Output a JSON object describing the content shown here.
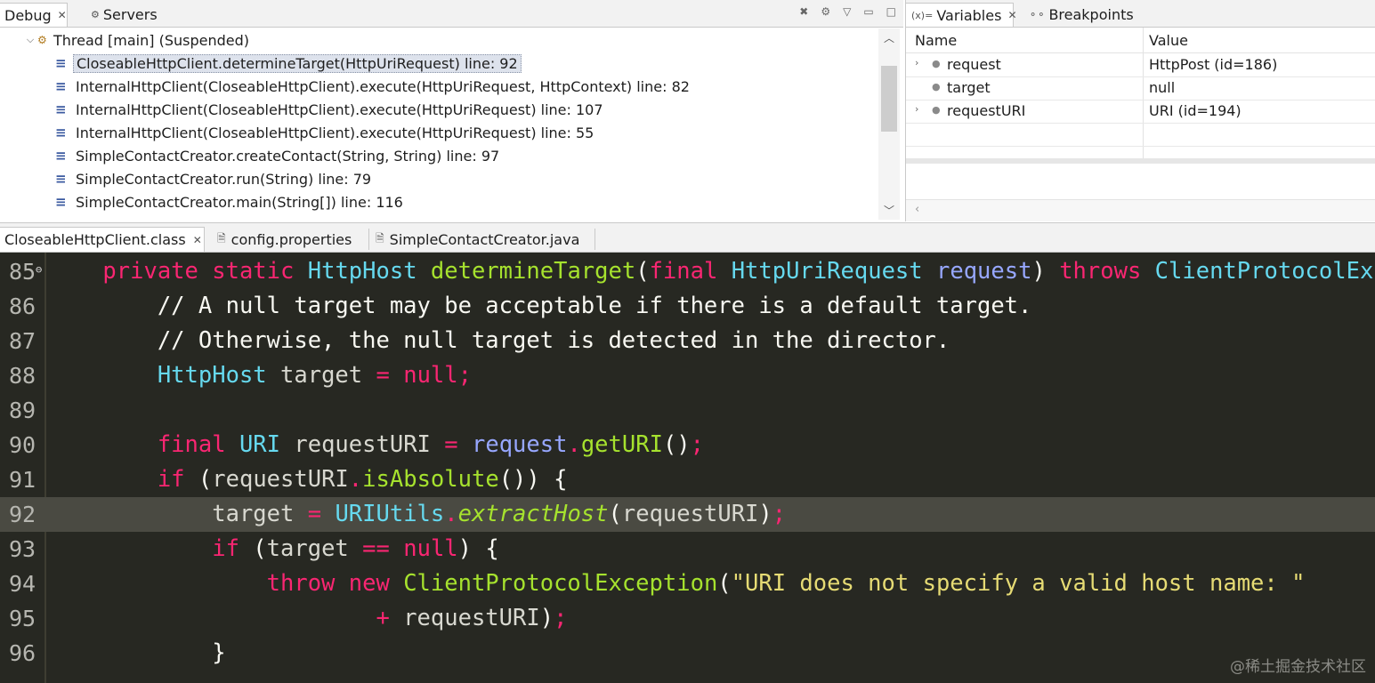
{
  "debug_view": {
    "tabs": [
      {
        "label": "Debug",
        "icon": "debug-icon",
        "active": true,
        "closable": true
      },
      {
        "label": "Servers",
        "icon": "servers-icon",
        "active": false,
        "closable": false
      }
    ],
    "thread": {
      "label": "Thread [main] (Suspended)",
      "icon": "thread-icon"
    },
    "stack_frames": [
      {
        "label": "CloseableHttpClient.determineTarget(HttpUriRequest) line: 92",
        "selected": true
      },
      {
        "label": "InternalHttpClient(CloseableHttpClient).execute(HttpUriRequest, HttpContext) line: 82",
        "selected": false
      },
      {
        "label": "InternalHttpClient(CloseableHttpClient).execute(HttpUriRequest) line: 107",
        "selected": false
      },
      {
        "label": "InternalHttpClient(CloseableHttpClient).execute(HttpUriRequest) line: 55",
        "selected": false
      },
      {
        "label": "SimpleContactCreator.createContact(String, String) line: 97",
        "selected": false
      },
      {
        "label": "SimpleContactCreator.run(String) line: 79",
        "selected": false
      },
      {
        "label": "SimpleContactCreator.main(String[]) line: 116",
        "selected": false
      }
    ]
  },
  "variables_view": {
    "tabs": [
      {
        "label": "Variables",
        "icon": "variables-icon",
        "active": true,
        "closable": true
      },
      {
        "label": "Breakpoints",
        "icon": "breakpoints-icon",
        "active": false,
        "closable": false
      }
    ],
    "columns": {
      "name": "Name",
      "value": "Value"
    },
    "rows": [
      {
        "name": "request",
        "value": "HttpPost  (id=186)",
        "expandable": true
      },
      {
        "name": "target",
        "value": "null",
        "expandable": false
      },
      {
        "name": "requestURI",
        "value": "URI  (id=194)",
        "expandable": true
      }
    ]
  },
  "editor": {
    "tabs": [
      {
        "label": "CloseableHttpClient.class",
        "icon": "class-file-icon",
        "active": true,
        "closable": true
      },
      {
        "label": "config.properties",
        "icon": "properties-file-icon",
        "active": false,
        "closable": false
      },
      {
        "label": "SimpleContactCreator.java",
        "icon": "java-file-icon",
        "active": false,
        "closable": false
      }
    ],
    "current_line": "92",
    "lines": [
      {
        "number": "85",
        "indent": "    ",
        "tokens": [
          {
            "t": "private",
            "c": "kw"
          },
          {
            "t": " ",
            "c": "punc"
          },
          {
            "t": "static",
            "c": "kw"
          },
          {
            "t": " ",
            "c": "punc"
          },
          {
            "t": "HttpHost",
            "c": "type"
          },
          {
            "t": " ",
            "c": "punc"
          },
          {
            "t": "determineTarget",
            "c": "method"
          },
          {
            "t": "(",
            "c": "punc"
          },
          {
            "t": "final",
            "c": "kw"
          },
          {
            "t": " ",
            "c": "punc"
          },
          {
            "t": "HttpUriRequest",
            "c": "type"
          },
          {
            "t": " ",
            "c": "punc"
          },
          {
            "t": "request",
            "c": "param"
          },
          {
            "t": ") ",
            "c": "punc"
          },
          {
            "t": "throws",
            "c": "kw"
          },
          {
            "t": " ",
            "c": "punc"
          },
          {
            "t": "ClientProtocolExcep",
            "c": "type"
          }
        ]
      },
      {
        "number": "86",
        "indent": "        ",
        "tokens": [
          {
            "t": "// A null target may be acceptable if there is a default target.",
            "c": "cmt"
          }
        ]
      },
      {
        "number": "87",
        "indent": "        ",
        "tokens": [
          {
            "t": "// Otherwise, the null target is detected in the director.",
            "c": "cmt"
          }
        ]
      },
      {
        "number": "88",
        "indent": "        ",
        "tokens": [
          {
            "t": "HttpHost",
            "c": "type"
          },
          {
            "t": " ",
            "c": "punc"
          },
          {
            "t": "target",
            "c": "dvar"
          },
          {
            "t": " ",
            "c": "punc"
          },
          {
            "t": "=",
            "c": "op"
          },
          {
            "t": " ",
            "c": "punc"
          },
          {
            "t": "null",
            "c": "kw"
          },
          {
            "t": ";",
            "c": "op"
          }
        ]
      },
      {
        "number": "89",
        "indent": "",
        "tokens": []
      },
      {
        "number": "90",
        "indent": "        ",
        "tokens": [
          {
            "t": "final",
            "c": "kw"
          },
          {
            "t": " ",
            "c": "punc"
          },
          {
            "t": "URI",
            "c": "type"
          },
          {
            "t": " ",
            "c": "punc"
          },
          {
            "t": "requestURI",
            "c": "dvar"
          },
          {
            "t": " ",
            "c": "punc"
          },
          {
            "t": "=",
            "c": "op"
          },
          {
            "t": " ",
            "c": "punc"
          },
          {
            "t": "request",
            "c": "param"
          },
          {
            "t": ".",
            "c": "op"
          },
          {
            "t": "getURI",
            "c": "method"
          },
          {
            "t": "()",
            "c": "punc"
          },
          {
            "t": ";",
            "c": "op"
          }
        ]
      },
      {
        "number": "91",
        "indent": "        ",
        "tokens": [
          {
            "t": "if",
            "c": "kw"
          },
          {
            "t": " (",
            "c": "punc"
          },
          {
            "t": "requestURI",
            "c": "dvar"
          },
          {
            "t": ".",
            "c": "op"
          },
          {
            "t": "isAbsolute",
            "c": "method"
          },
          {
            "t": "()) {",
            "c": "punc"
          }
        ]
      },
      {
        "number": "92",
        "indent": "            ",
        "tokens": [
          {
            "t": "target",
            "c": "dvar"
          },
          {
            "t": " ",
            "c": "punc"
          },
          {
            "t": "=",
            "c": "op"
          },
          {
            "t": " ",
            "c": "punc"
          },
          {
            "t": "URIUtils",
            "c": "type"
          },
          {
            "t": ".",
            "c": "op"
          },
          {
            "t": "extractHost",
            "c": "italic-method"
          },
          {
            "t": "(",
            "c": "punc"
          },
          {
            "t": "requestURI",
            "c": "dvar"
          },
          {
            "t": ")",
            "c": "punc"
          },
          {
            "t": ";",
            "c": "op"
          }
        ]
      },
      {
        "number": "93",
        "indent": "            ",
        "tokens": [
          {
            "t": "if",
            "c": "kw"
          },
          {
            "t": " (",
            "c": "punc"
          },
          {
            "t": "target",
            "c": "dvar"
          },
          {
            "t": " ",
            "c": "punc"
          },
          {
            "t": "==",
            "c": "op"
          },
          {
            "t": " ",
            "c": "punc"
          },
          {
            "t": "null",
            "c": "kw"
          },
          {
            "t": ") {",
            "c": "punc"
          }
        ]
      },
      {
        "number": "94",
        "indent": "                ",
        "tokens": [
          {
            "t": "throw",
            "c": "kw"
          },
          {
            "t": " ",
            "c": "punc"
          },
          {
            "t": "new",
            "c": "kw"
          },
          {
            "t": " ",
            "c": "punc"
          },
          {
            "t": "ClientProtocolException",
            "c": "method"
          },
          {
            "t": "(",
            "c": "punc"
          },
          {
            "t": "\"URI does not specify a valid host name: \"",
            "c": "str"
          }
        ]
      },
      {
        "number": "95",
        "indent": "                        ",
        "tokens": [
          {
            "t": "+",
            "c": "op"
          },
          {
            "t": " ",
            "c": "punc"
          },
          {
            "t": "requestURI",
            "c": "dvar"
          },
          {
            "t": ")",
            "c": "punc"
          },
          {
            "t": ";",
            "c": "op"
          }
        ]
      },
      {
        "number": "96",
        "indent": "            ",
        "tokens": [
          {
            "t": "}",
            "c": "punc"
          }
        ]
      }
    ]
  },
  "watermark": "@稀土掘金技术社区",
  "colors": {
    "editor_bg": "#272822",
    "current_line_bg": "#4a4a42",
    "keyword": "#f92672",
    "type": "#66d9ef",
    "method": "#a6e22e",
    "string": "#e6db74",
    "param": "#97a7ff"
  }
}
